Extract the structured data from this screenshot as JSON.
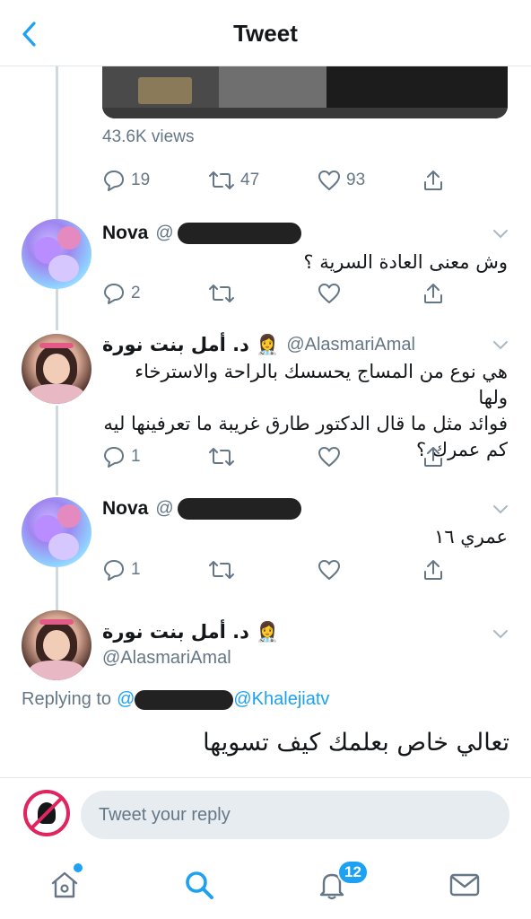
{
  "header": {
    "title": "Tweet"
  },
  "media": {
    "views": "43.6K views"
  },
  "main_tweet_actions": {
    "replies": "19",
    "retweets": "47",
    "likes": "93"
  },
  "replies": [
    {
      "name": "Nova",
      "handle_prefix": "@",
      "text": "وش معنى العادة السرية ؟",
      "reply_count": "2"
    },
    {
      "name": "د. أمل بنت نورة",
      "emoji": "👩‍⚕️",
      "handle": "@AlasmariAmal",
      "text_lines": [
        "هي نوع من المساج يحسسك بالراحة والاسترخاء ولها",
        "فوائد مثل ما قال الدكتور طارق غريبة ما تعرفينها ليه",
        "كم عمرك ؟"
      ],
      "reply_count": "1"
    },
    {
      "name": "Nova",
      "handle_prefix": "@",
      "text": "عمري ١٦",
      "reply_count": "1"
    }
  ],
  "focused_tweet": {
    "name": "د. أمل بنت نورة",
    "emoji": "👩‍⚕️",
    "handle": "@AlasmariAmal",
    "replying_label": "Replying to",
    "replying_at": "@",
    "replying_to_2": "@Khalejiatv",
    "text": "تعالي خاص بعلمك كيف تسويها"
  },
  "reply_bar": {
    "placeholder": "Tweet your reply"
  },
  "tabbar": {
    "notifications_badge": "12"
  },
  "colors": {
    "accent": "#1da1f2",
    "muted": "#657786",
    "divider": "#e1e8ed"
  }
}
